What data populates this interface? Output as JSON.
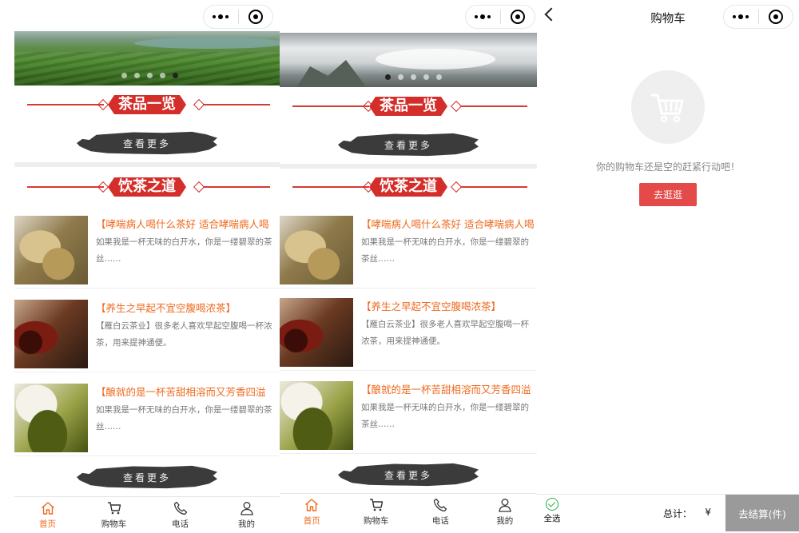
{
  "accent_color": "#ef6a1e",
  "brand_red": "#d42e2b",
  "home": {
    "banner_slides": 5,
    "section_products": "茶品一览",
    "section_culture": "饮茶之道",
    "see_more": "查看更多",
    "articles": [
      {
        "title": "【哮喘病人喝什么茶好 适合哮喘病人喝",
        "desc": "如果我是一杯无味的白开水，你是一缕碧翠的茶丝……"
      },
      {
        "title": "【养生之早起不宜空腹喝浓茶】",
        "desc": "【雁白云茶业】很多老人喜欢早起空腹喝一杯浓茶，用来提神通便。"
      },
      {
        "title": "【酿就的是一杯苦甜相溶而又芳香四溢",
        "desc": "如果我是一杯无味的白开水，你是一缕碧翠的茶丝……"
      }
    ]
  },
  "tabbar": [
    {
      "label": "首页",
      "icon": "home-icon",
      "active": true
    },
    {
      "label": "购物车",
      "icon": "cart-icon",
      "active": false
    },
    {
      "label": "电话",
      "icon": "phone-icon",
      "active": false
    },
    {
      "label": "我的",
      "icon": "user-icon",
      "active": false
    }
  ],
  "cart": {
    "title": "购物车",
    "empty_text": "你的购物车还是空的赶紧行动吧！",
    "go_button": "去逛逛",
    "select_all": "全选",
    "total_label": "总计：",
    "total_value": "¥",
    "checkout": "去结算(件)"
  }
}
